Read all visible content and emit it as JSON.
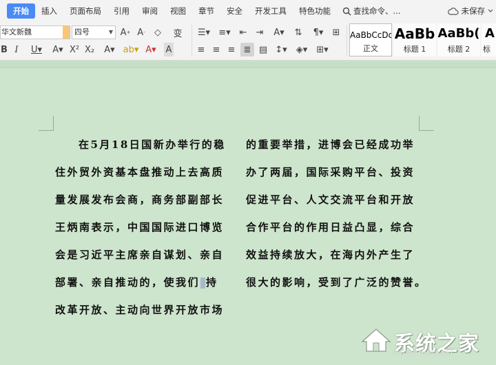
{
  "menu": {
    "items": [
      "开始",
      "插入",
      "页面布局",
      "引用",
      "审阅",
      "视图",
      "章节",
      "安全",
      "开发工具",
      "特色功能"
    ],
    "search_label": "查找命令、...",
    "save_status": "未保存"
  },
  "ribbon": {
    "font_name": "华文新魏",
    "font_size": "四号",
    "styles": [
      {
        "sample": "AaBbCcDd",
        "label": "正文"
      },
      {
        "sample": "AaBb",
        "label": "标题 1"
      },
      {
        "sample": "AaBb(",
        "label": "标题 2"
      },
      {
        "sample": "A",
        "label": "标"
      }
    ]
  },
  "document": {
    "left_column": [
      "在5月18日国新办举行的稳",
      "住外贸外资基本盘推动上去高质",
      "量发展发布会商，商务部副部长",
      "王炳南表示，中国国际进口博览",
      "会是习近平主席亲自谋划、亲自",
      "部署、亲自推动的，使我们",
      "改革开放、主动向世界开放市场"
    ],
    "left_line6_tail": "持",
    "right_column": [
      "的重要举措，进博会已经成功举",
      "办了两届，国际采购平台、投资",
      "促进平台、人文交流平台和开放",
      "合作平台的作用日益凸显，综合",
      "效益持续放大，在海内外产生了",
      "很大的影响，受到了广泛的赞誉。"
    ]
  },
  "watermark": {
    "title": "系统之家",
    "url": "XITONGZHIJIA.NET"
  },
  "colors": {
    "accent": "#4a8af4",
    "doc_background": "#cde5cc",
    "ribbon_background": "#f3f3f3"
  }
}
